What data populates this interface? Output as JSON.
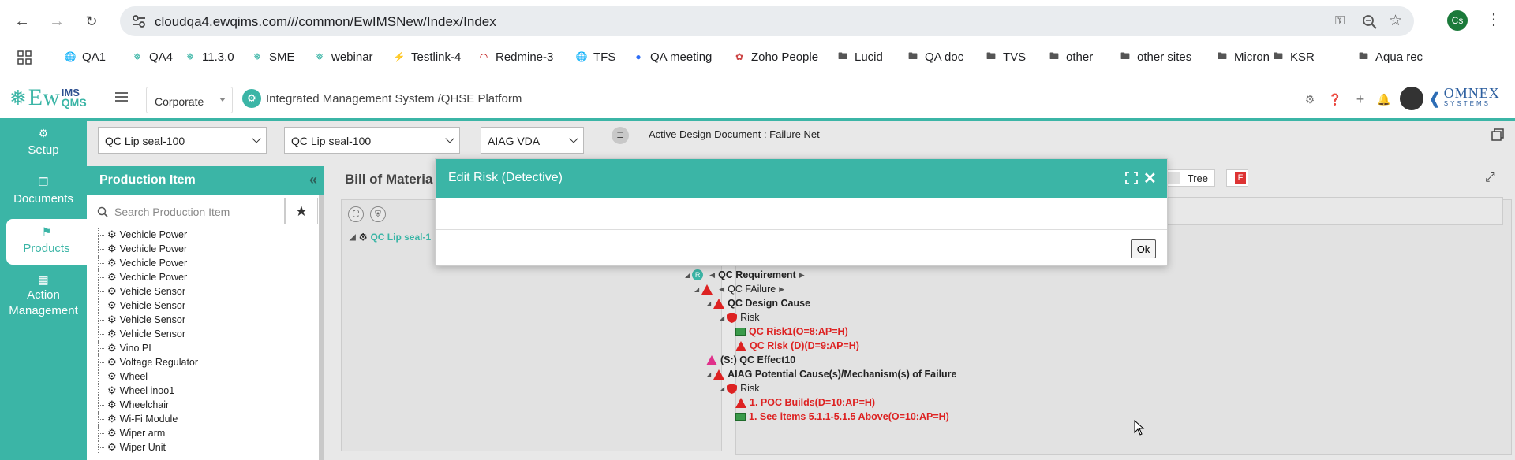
{
  "browser": {
    "url": "cloudqa4.ewqims.com///common/EwIMSNew/Index/Index",
    "profile_initials": "Cs"
  },
  "bookmarks": [
    {
      "label": "QA1",
      "icon": "globe-icon"
    },
    {
      "label": "QA4",
      "icon": "ewqims-icon"
    },
    {
      "label": "11.3.0",
      "icon": "ewqims-icon"
    },
    {
      "label": "SME",
      "icon": "ewqims-icon"
    },
    {
      "label": "webinar",
      "icon": "ewqims-icon"
    },
    {
      "label": "Testlink-4",
      "icon": "testlink-icon"
    },
    {
      "label": "Redmine-3",
      "icon": "redmine-icon"
    },
    {
      "label": "TFS",
      "icon": "globe-icon"
    },
    {
      "label": "QA meeting",
      "icon": "zoom-icon"
    },
    {
      "label": "Zoho People",
      "icon": "zoho-icon"
    },
    {
      "label": "Lucid",
      "icon": "folder-icon"
    },
    {
      "label": "QA doc",
      "icon": "folder-icon"
    },
    {
      "label": "TVS",
      "icon": "folder-icon"
    },
    {
      "label": "other",
      "icon": "folder-icon"
    },
    {
      "label": "other sites",
      "icon": "folder-icon"
    },
    {
      "label": "Micron",
      "icon": "folder-icon"
    },
    {
      "label": "KSR",
      "icon": "folder-icon"
    },
    {
      "label": "Aqua rec",
      "icon": "folder-icon"
    }
  ],
  "header": {
    "logo_text": "Ew",
    "logo_sub_top": "IMS",
    "logo_sub_bottom": "QMS",
    "company": "Corporate",
    "platform_title": "Integrated Management System /QHSE Platform",
    "brand": "OMNEX",
    "brand_sub": "SYSTEMS"
  },
  "sidebar": {
    "items": [
      {
        "label": "Setup",
        "icon": "gears-icon"
      },
      {
        "label": "Documents",
        "icon": "documents-icon"
      },
      {
        "label": "Products",
        "icon": "products-icon"
      },
      {
        "label": "Action Management",
        "icon": "action-icon"
      }
    ]
  },
  "filters": {
    "product1": "QC Lip seal-100",
    "product2": "QC Lip seal-100",
    "standard": "AIAG VDA",
    "active_doc": "Active Design Document : Failure Net"
  },
  "production": {
    "title": "Production Item",
    "search_placeholder": "Search Production Item",
    "items": [
      "Vechicle Power",
      "Vechicle Power",
      "Vechicle Power",
      "Vechicle Power",
      "Vehicle Sensor",
      "Vehicle Sensor",
      "Vehicle Sensor",
      "Vehicle Sensor",
      "Vino PI",
      "Voltage Regulator",
      "Wheel",
      "Wheel inoo1",
      "Wheelchair",
      "Wi-Fi Module",
      "Wiper arm",
      "Wiper Unit"
    ]
  },
  "bom": {
    "title": "Bill of Materia",
    "node": "QC Lip seal-1"
  },
  "right": {
    "tree_label": "Tree",
    "f_label": "F",
    "rows": [
      {
        "text": "QC Requirement",
        "kind": "requirement"
      },
      {
        "text": "QC FAilure",
        "kind": "failure"
      },
      {
        "text": "QC Design Cause",
        "kind": "cause"
      },
      {
        "text": "Risk",
        "kind": "risk"
      },
      {
        "text": "QC Risk1(O=8:AP=H)",
        "kind": "risk-o"
      },
      {
        "text": "QC Risk (D)(D=9:AP=H)",
        "kind": "risk-d"
      },
      {
        "text": "(S:) QC Effect10",
        "kind": "effect"
      },
      {
        "text": "AIAG Potential Cause(s)/Mechanism(s) of Failure",
        "kind": "cause"
      },
      {
        "text": "Risk",
        "kind": "risk"
      },
      {
        "text": "1. POC Builds(D=10:AP=H)",
        "kind": "risk-d"
      },
      {
        "text": "1. See items 5.1.1-5.1.5 Above(O=10:AP=H)",
        "kind": "risk-o"
      }
    ]
  },
  "modal": {
    "title": "Edit Risk (Detective)",
    "ok_label": "Ok"
  },
  "colors": {
    "accent": "#3bb5a6",
    "risk_red": "#d22222"
  }
}
